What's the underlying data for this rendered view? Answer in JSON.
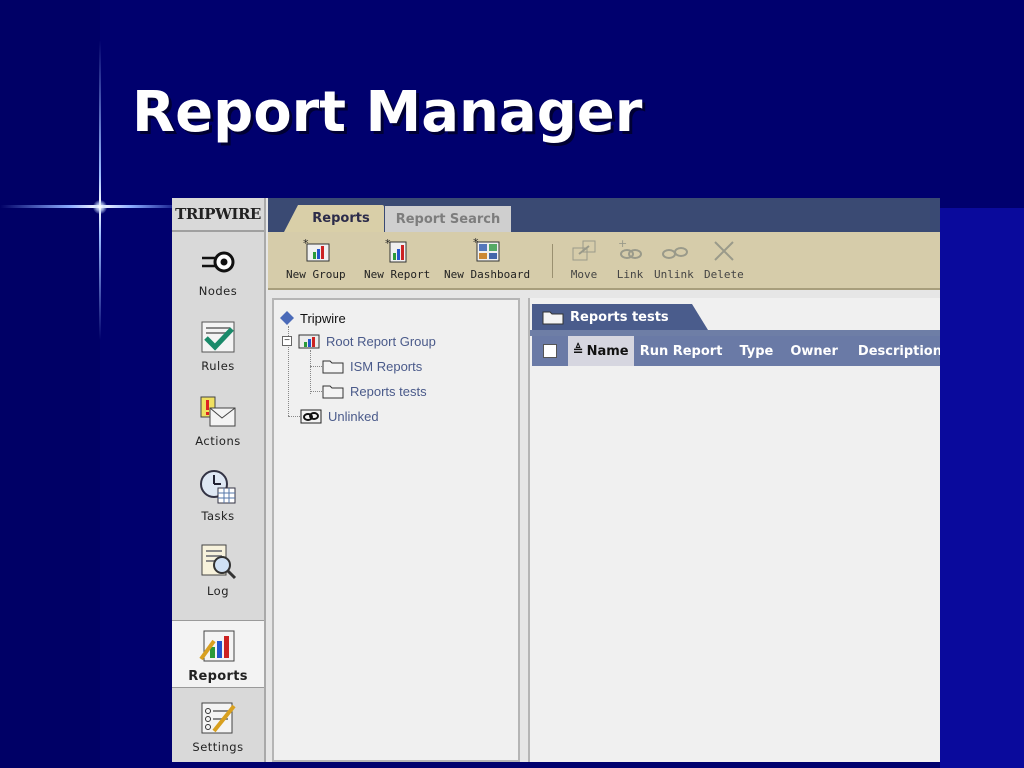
{
  "slide": {
    "title": "Report Manager"
  },
  "app": {
    "logo_text": "TRIPWIRE",
    "nav": [
      {
        "label": "Nodes",
        "icon": "nodes-icon",
        "active": false
      },
      {
        "label": "Rules",
        "icon": "rules-icon",
        "active": false
      },
      {
        "label": "Actions",
        "icon": "actions-icon",
        "active": false
      },
      {
        "label": "Tasks",
        "icon": "tasks-icon",
        "active": false
      },
      {
        "label": "Log",
        "icon": "log-icon",
        "active": false
      },
      {
        "label": "Reports",
        "icon": "reports-icon",
        "active": true
      },
      {
        "label": "Settings",
        "icon": "settings-icon",
        "active": false
      }
    ],
    "tabs": [
      {
        "label": "Reports",
        "active": true
      },
      {
        "label": "Report Search",
        "active": false
      }
    ],
    "toolbar": [
      {
        "label": "New Group",
        "icon": "new-group-icon",
        "enabled": true
      },
      {
        "label": "New Report",
        "icon": "new-report-icon",
        "enabled": true
      },
      {
        "label": "New Dashboard",
        "icon": "new-dashboard-icon",
        "enabled": true
      },
      {
        "label": "Move",
        "icon": "move-icon",
        "enabled": false
      },
      {
        "label": "Link",
        "icon": "link-icon",
        "enabled": false
      },
      {
        "label": "Unlink",
        "icon": "unlink-icon",
        "enabled": false
      },
      {
        "label": "Delete",
        "icon": "delete-icon",
        "enabled": false
      }
    ],
    "tree": {
      "root": "Tripwire",
      "group": "Root Report Group",
      "children": [
        "ISM Reports",
        "Reports tests"
      ],
      "unlinked": "Unlinked"
    },
    "panel": {
      "title": "Reports tests",
      "columns": [
        "Name",
        "Run Report",
        "Type",
        "Owner",
        "Description"
      ],
      "sort_indicator": "≜"
    },
    "colors": {
      "slide_bg": "#00006e",
      "tab_bar": "#3a4a73",
      "toolbar": "#d6ccaa",
      "grid_header": "#6a7aa6"
    }
  }
}
